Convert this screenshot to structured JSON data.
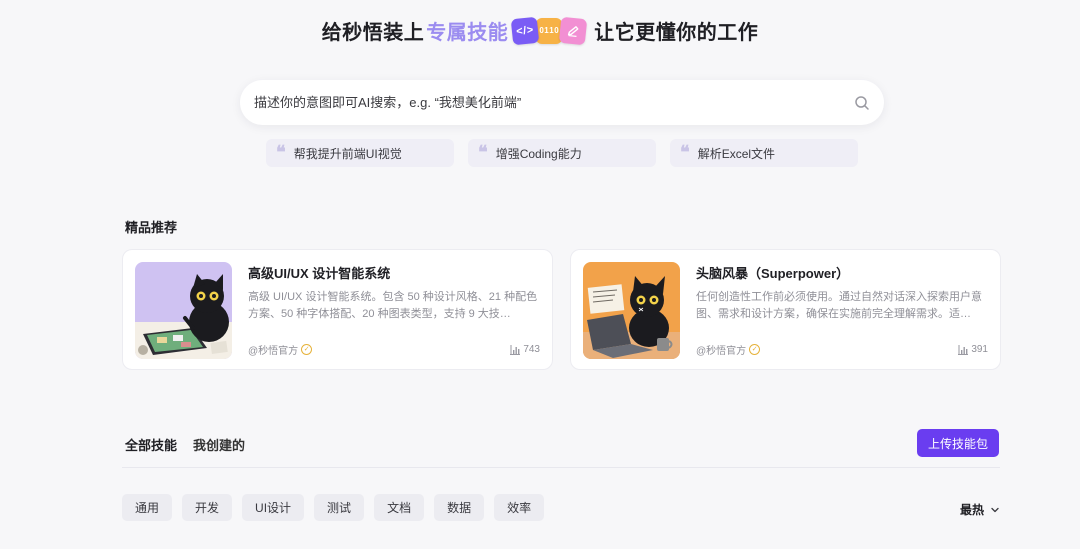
{
  "hero": {
    "title_prefix": "给秒悟装上",
    "title_accent": "专属技能",
    "title_suffix": "让它更懂你的工作",
    "badge_code": "</>",
    "badge_bin_1": "01",
    "badge_bin_2": "10"
  },
  "search": {
    "placeholder": "描述你的意图即可AI搜索，e.g. “我想美化前端”"
  },
  "suggestions": [
    {
      "label": "帮我提升前端UI视觉"
    },
    {
      "label": "增强Coding能力"
    },
    {
      "label": "解析Excel文件"
    }
  ],
  "featured": {
    "title": "精品推荐",
    "cards": [
      {
        "title": "高级UI/UX 设计智能系统",
        "description": "高级 UI/UX 设计智能系统。包含 50 种设计风格、21 种配色方案、50 种字体搭配、20 种图表类型，支持 9 大技…",
        "author": "@秒悟官方",
        "views": "743"
      },
      {
        "title": "头脑风暴（Superpower）",
        "description": "任何创造性工作前必须使用。通过自然对话深入探索用户意图、需求和设计方案，确保在实施前完全理解需求。适…",
        "author": "@秒悟官方",
        "views": "391"
      }
    ]
  },
  "tabs": [
    {
      "label": "全部技能"
    },
    {
      "label": "我创建的"
    }
  ],
  "upload_label": "上传技能包",
  "filters": [
    {
      "label": "通用"
    },
    {
      "label": "开发"
    },
    {
      "label": "UI设计"
    },
    {
      "label": "测试"
    },
    {
      "label": "文档"
    },
    {
      "label": "数据"
    },
    {
      "label": "效率"
    }
  ],
  "sort": {
    "label": "最热"
  },
  "colors": {
    "accent": "#6a3df0",
    "title_accent": "#9b8cf0",
    "verified": "#e6b23a"
  }
}
